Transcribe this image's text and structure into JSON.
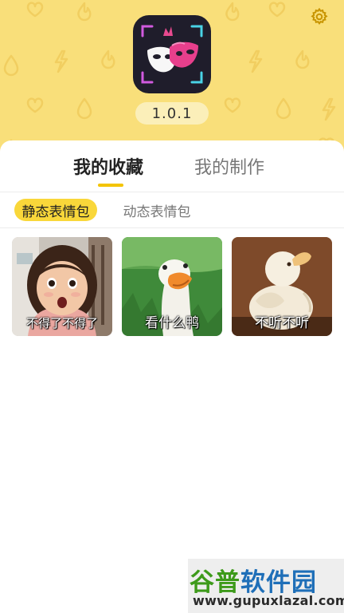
{
  "header": {
    "version": "1.0.1",
    "settings_icon": "gear-icon",
    "logo_icon": "carnival-mask-icon",
    "pattern_icons": [
      "heart-icon",
      "flame-icon",
      "droplet-icon",
      "lightning-icon"
    ],
    "background_color": "#f9df7a",
    "accent_color": "#f4c400"
  },
  "tabs": {
    "main": [
      {
        "label": "我的收藏",
        "active": true
      },
      {
        "label": "我的制作",
        "active": false
      }
    ],
    "sub": [
      {
        "label": "静态表情包",
        "active": true
      },
      {
        "label": "动态表情包",
        "active": false
      }
    ]
  },
  "memes": [
    {
      "caption": "不得了不得了",
      "scene": "surprised-girl"
    },
    {
      "caption": "看什么鸭",
      "scene": "goose-on-grass"
    },
    {
      "caption": "不听不听",
      "scene": "white-duck"
    }
  ],
  "watermark": {
    "title_part1": "谷普",
    "title_part2": "软件园",
    "url": "www.gupuxlazal.com"
  }
}
